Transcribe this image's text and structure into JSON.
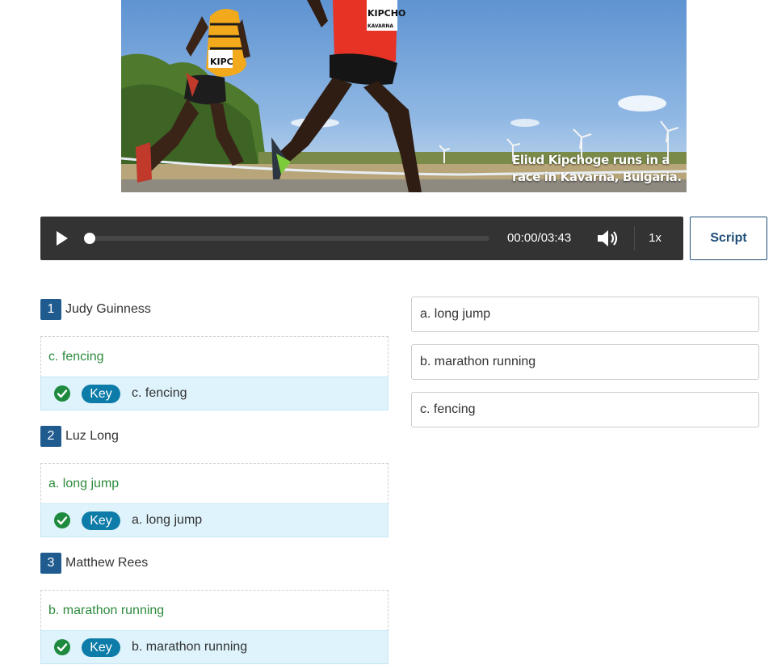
{
  "photo": {
    "caption_line1": "Eliud Kipchoge runs in a",
    "caption_line2": "race in Kavarna, Bulgaria.",
    "bib_left": "KIPC",
    "bib_right": "KIPCHO",
    "bib_right_sub": "KAVARNA"
  },
  "player": {
    "play_icon": "play-icon",
    "time": "00:00/03:43",
    "progress": 0,
    "volume_icon": "volume-icon",
    "speed": "1x"
  },
  "script_button": "Script",
  "questions": [
    {
      "number": "1",
      "name": "Judy Guinness",
      "answer": "c. fencing",
      "key_label": "Key",
      "key_answer": "c. fencing"
    },
    {
      "number": "2",
      "name": "Luz Long",
      "answer": "a. long jump",
      "key_label": "Key",
      "key_answer": "a. long jump"
    },
    {
      "number": "3",
      "name": "Matthew Rees",
      "answer": "b. marathon running",
      "key_label": "Key",
      "key_answer": "b. marathon running"
    }
  ],
  "options": [
    "a. long jump",
    "b. marathon running",
    "c. fencing"
  ],
  "colors": {
    "player_bg": "#333333",
    "accent_blue": "#1f5b8e",
    "correct_green": "#2e8b3e",
    "key_badge": "#0d7ca8",
    "key_row_bg": "#def3fc"
  }
}
